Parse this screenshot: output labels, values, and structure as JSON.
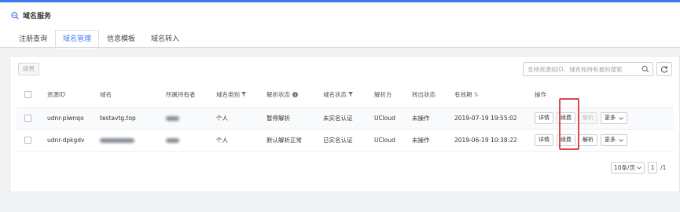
{
  "header": {
    "title": "域名服务",
    "tabs": [
      "注册查询",
      "域名管理",
      "信息模板",
      "域名转入"
    ],
    "active_tab": "域名管理"
  },
  "toolbar": {
    "renew_label": "续费",
    "search_placeholder": "支持资源组ID、域名和持有者的搜索"
  },
  "table": {
    "columns": [
      "资源ID",
      "域名",
      "所属持有者",
      "域名类别",
      "解析状态",
      "域名状态",
      "解析方",
      "转出状态",
      "有效期",
      "操作"
    ],
    "rows": [
      {
        "id": "udnr-piwnqo",
        "domain": "testavtg.top",
        "holder": "",
        "category": "个人",
        "resolve_status": "暂停解析",
        "domain_status": "未实名认证",
        "resolver": "UCloud",
        "transfer_status": "未操作",
        "expiry": "2019-07-19 19:55:02",
        "actions": {
          "detail": "详情",
          "renew": "续费",
          "resolve": "解析",
          "more": "更多"
        }
      },
      {
        "id": "udnr-dpkgdv",
        "domain": "",
        "holder": "",
        "category": "个人",
        "resolve_status": "默认解析正常",
        "domain_status": "已实名认证",
        "resolver": "UCloud",
        "transfer_status": "未操作",
        "expiry": "2019-06-19 10:38:22",
        "actions": {
          "detail": "详情",
          "renew": "续费",
          "resolve": "解析",
          "more": "更多"
        }
      }
    ]
  },
  "pagination": {
    "page_size": "10条/页",
    "page": "1",
    "total": "/1"
  },
  "colors": {
    "accent": "#3d7ce8",
    "highlight": "#d94a4a"
  },
  "icons": [
    "domain-service-icon",
    "search-icon",
    "refresh-icon",
    "filter-icon",
    "info-icon",
    "sort-icon",
    "chevron-down-icon"
  ]
}
